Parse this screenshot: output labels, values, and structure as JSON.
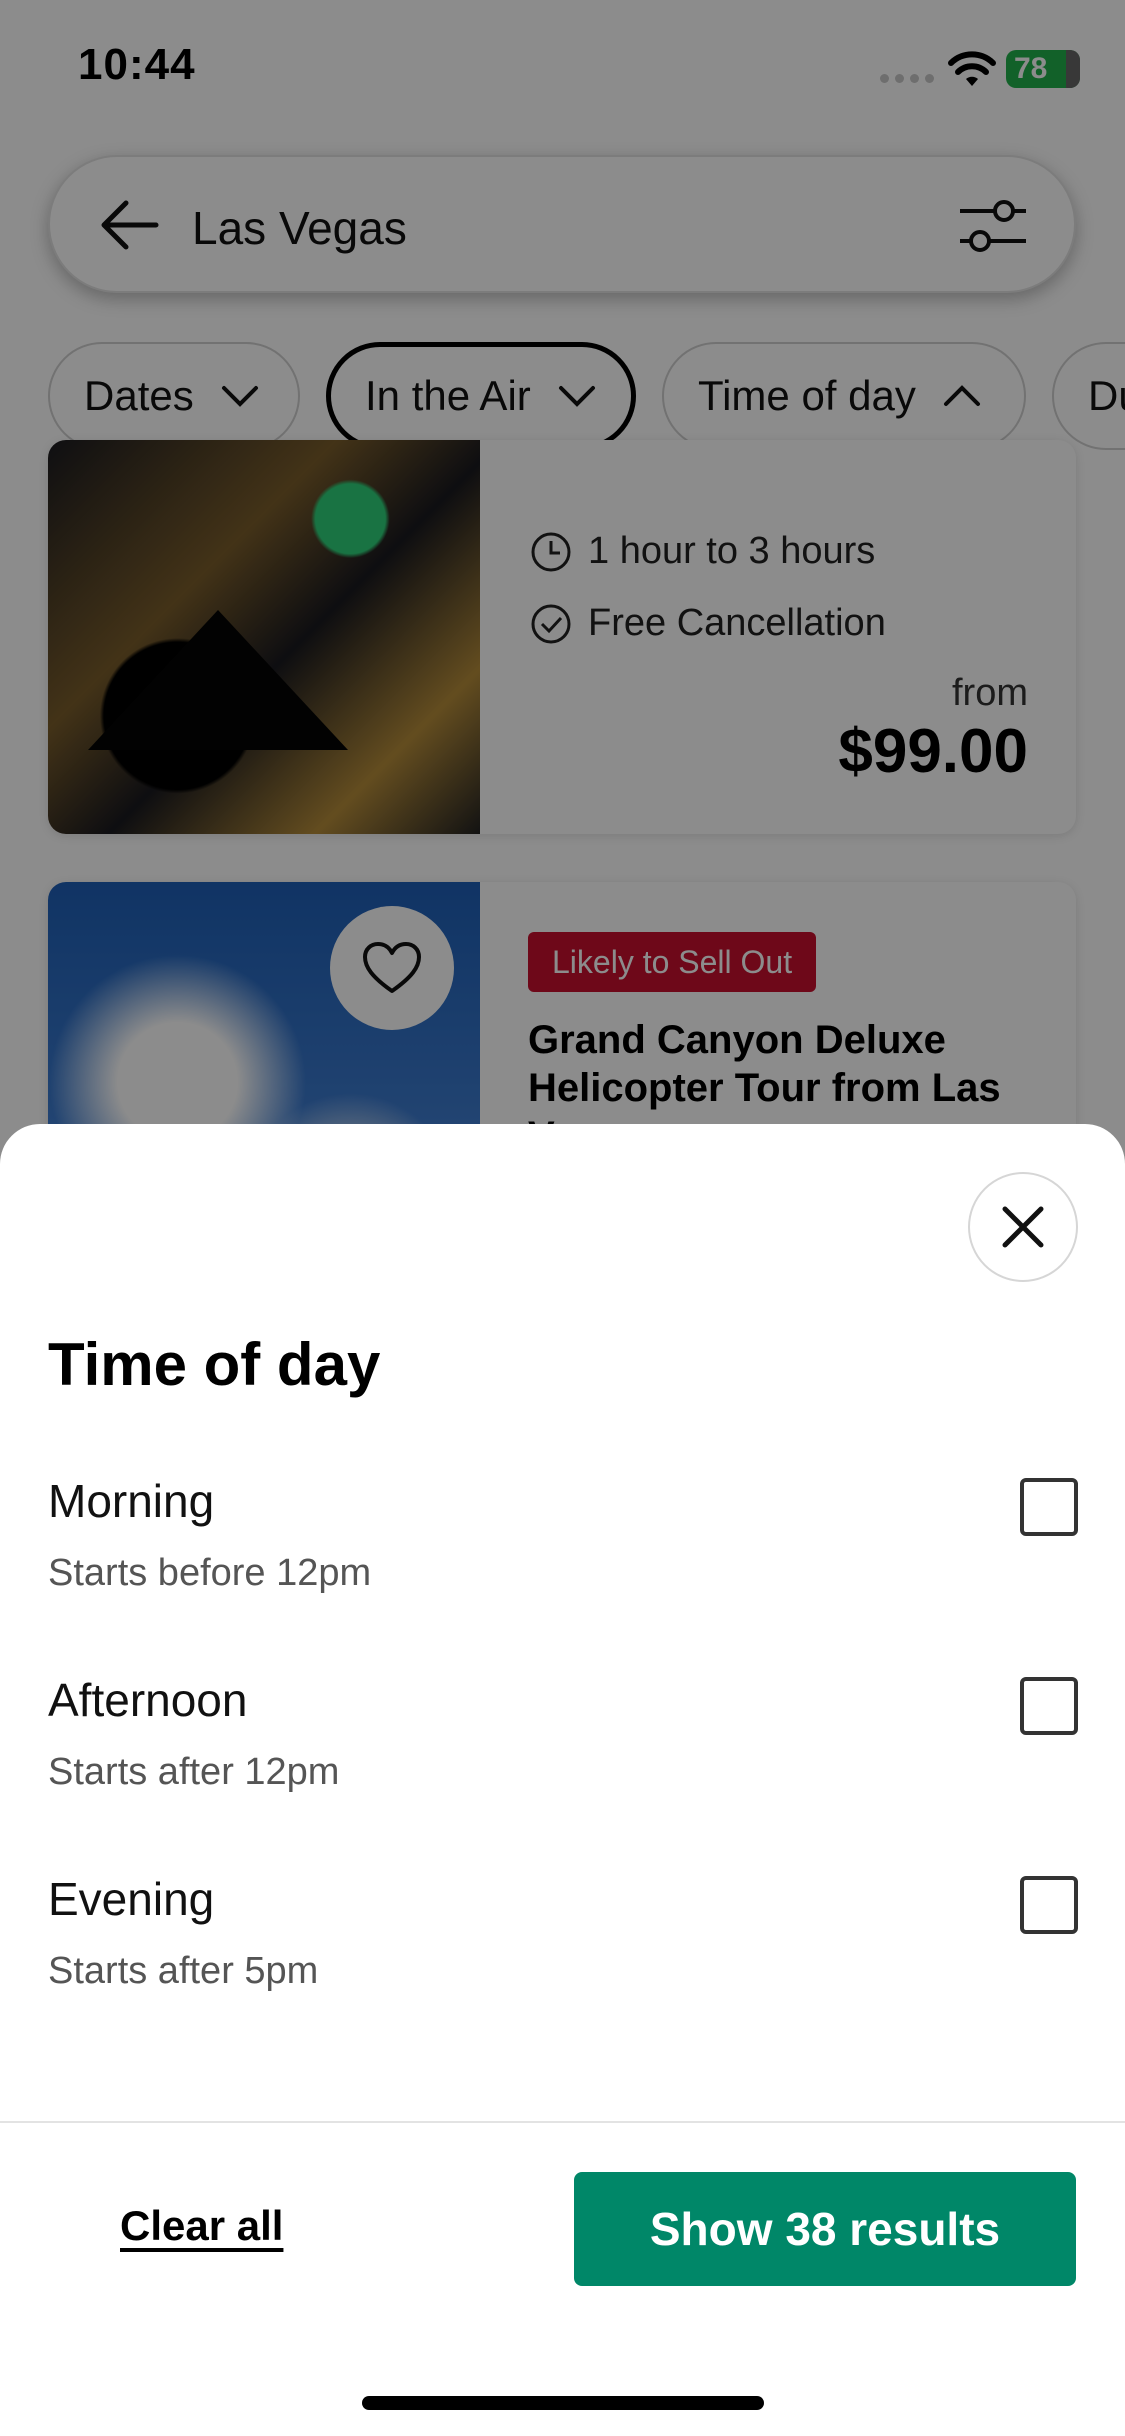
{
  "status_bar": {
    "time": "10:44",
    "battery": "78"
  },
  "search": {
    "query": "Las Vegas"
  },
  "chips": [
    {
      "label": "Dates"
    },
    {
      "label": "In the Air"
    },
    {
      "label": "Time of day"
    },
    {
      "label": "Du"
    }
  ],
  "results": [
    {
      "duration": "1 hour to 3 hours",
      "cancellation": "Free Cancellation",
      "from_label": "from",
      "price": "$99.00"
    },
    {
      "badge": "Likely to Sell Out",
      "title": "Grand Canyon Deluxe Helicopter Tour from Las Vegas"
    }
  ],
  "sheet": {
    "title": "Time of day",
    "options": [
      {
        "label": "Morning",
        "sub": "Starts before 12pm",
        "checked": false
      },
      {
        "label": "Afternoon",
        "sub": "Starts after 12pm",
        "checked": false
      },
      {
        "label": "Evening",
        "sub": "Starts after 5pm",
        "checked": false
      }
    ],
    "clear_label": "Clear all",
    "show_label": "Show 38 results"
  },
  "colors": {
    "accent": "#008768",
    "badge": "#c8102e"
  },
  "icons": [
    "back-arrow-icon",
    "filter-sliders-icon",
    "chevron-down-icon",
    "chevron-up-icon",
    "clock-icon",
    "check-circle-icon",
    "heart-icon",
    "close-icon"
  ]
}
